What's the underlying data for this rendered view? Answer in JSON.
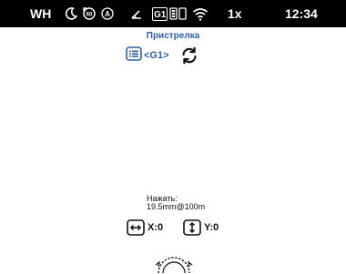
{
  "status_bar": {
    "wh_label": "WH",
    "moon_icon": "moon-icon",
    "timer_icon": "timer-icon",
    "auto_icon": "auto-mode-icon",
    "angle_icon": "angle-icon",
    "profile_badge": "G1",
    "battery_icon": "battery-icon",
    "wifi_icon": "wifi-icon",
    "zoom": "1x",
    "time": "12:34"
  },
  "header": {
    "title": "Пристрелка",
    "profile_label": "<G1>",
    "list_icon": "list-icon",
    "refresh_icon": "refresh-icon"
  },
  "hint": {
    "line1": "Нажать:",
    "line2": "19.5mm@100m"
  },
  "adjust": {
    "x_label": "X:0",
    "y_label": "Y:0",
    "x_icon": "horizontal-arrows-icon",
    "y_icon": "vertical-arrows-icon"
  },
  "knob_icon": "rotary-knob-icon",
  "colors": {
    "accent": "#2f5ea3",
    "status_bg": "#000000",
    "background": "#ffffff"
  }
}
